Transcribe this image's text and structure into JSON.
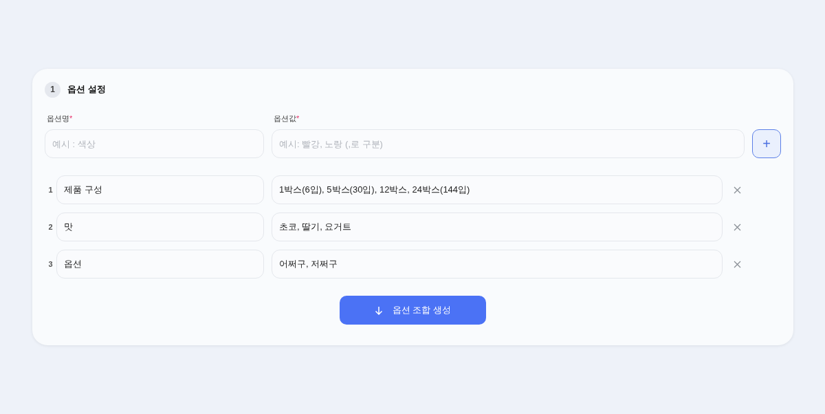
{
  "section": {
    "step": "1",
    "title": "옵션 설정"
  },
  "new_option": {
    "name_label": "옵션명",
    "name_mark": "*",
    "name_placeholder": "예시 : 색상",
    "value_label": "옵션값",
    "value_mark": "*",
    "value_placeholder": "예시: 빨강, 노랑 (,로 구분)",
    "add_button": "+"
  },
  "options": [
    {
      "index": "1",
      "name": "제품 구성",
      "values": "1박스(6입), 5박스(30입), 12박스, 24박스(144입)"
    },
    {
      "index": "2",
      "name": "맛",
      "values": "초코, 딸기, 요거트"
    },
    {
      "index": "3",
      "name": "옵션",
      "values": "어쩌구, 저쩌구"
    }
  ],
  "generate_button": "옵션 조합 생성"
}
